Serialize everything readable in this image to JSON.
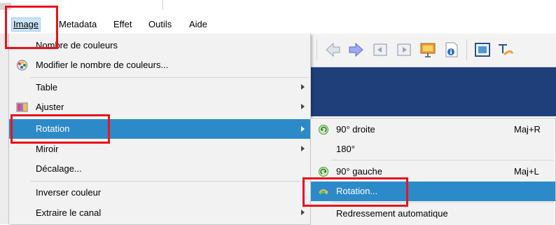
{
  "menubar": {
    "items": [
      {
        "label": "Image",
        "active": true
      },
      {
        "label": "Metadata"
      },
      {
        "label": "Effet"
      },
      {
        "label": "Outils"
      },
      {
        "label": "Aide"
      }
    ]
  },
  "toolbar": {
    "icons": [
      "arrow-left-icon",
      "arrow-right-icon",
      "page-back-icon",
      "page-forward-icon",
      "slideshow-icon",
      "info-icon",
      "fullscreen-icon",
      "text-icon"
    ]
  },
  "image_menu": {
    "items": [
      {
        "label": "Nombre de couleurs",
        "has_icon": false
      },
      {
        "label": "Modifier le nombre de couleurs...",
        "icon": "palette-icon"
      },
      {
        "label": "Table",
        "submenu": true
      },
      {
        "label": "Ajuster",
        "icon": "adjust-icon",
        "submenu": true
      },
      {
        "label": "Rotation",
        "submenu": true,
        "highlighted": true
      },
      {
        "label": "Miroir",
        "submenu": true
      },
      {
        "label": "Décalage..."
      },
      {
        "label": "Inverser couleur"
      },
      {
        "label": "Extraire le canal",
        "submenu": true
      }
    ]
  },
  "rotation_submenu": {
    "items": [
      {
        "label": "90° droite",
        "shortcut": "Maj+R",
        "icon": "rotate-right-icon"
      },
      {
        "label": "180°"
      },
      {
        "label": "90° gauche",
        "shortcut": "Maj+L",
        "icon": "rotate-left-icon"
      },
      {
        "label": "Rotation...",
        "icon": "rotate-free-icon",
        "highlighted": true
      },
      {
        "label": "Redressement automatique"
      }
    ]
  },
  "colors": {
    "highlight": "#2d8ac9",
    "annotation": "#e8141b",
    "banner": "#1f3f7a"
  }
}
